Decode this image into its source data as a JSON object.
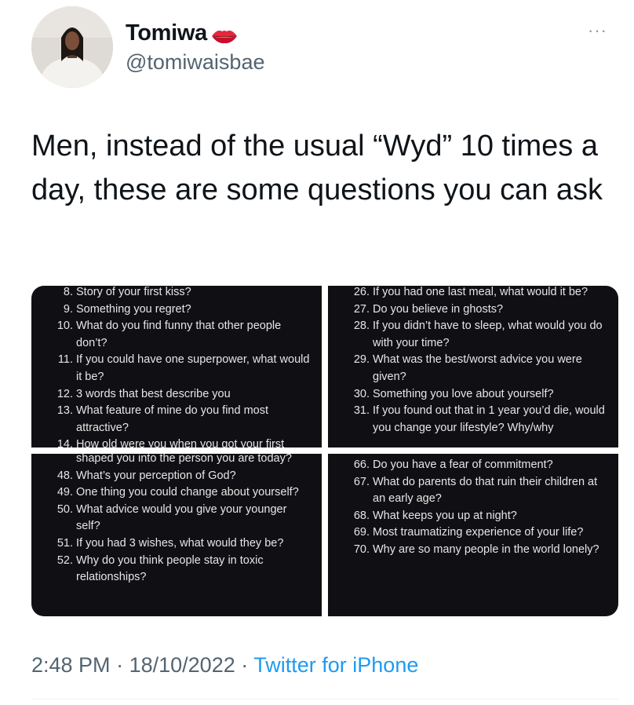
{
  "author": {
    "display_name": "Tomiwa",
    "handle": "@tomiwaisbae"
  },
  "tweet": {
    "text": "Men, instead of the usual “Wyd” 10 times a day, these are some questions you can ask"
  },
  "panels": {
    "top_left": [
      {
        "num": "8.",
        "text": "Story of your first kiss?"
      },
      {
        "num": "9.",
        "text": "Something you regret?"
      },
      {
        "num": "10.",
        "text": "What do you find funny that other people don’t?"
      },
      {
        "num": "11.",
        "text": "If you could have one superpower, what would it be?"
      },
      {
        "num": "12.",
        "text": "3 words that best describe you"
      },
      {
        "num": "13.",
        "text": "What feature of mine do you find most attractive?"
      },
      {
        "num": "14.",
        "text": "How old were you when you got your first"
      }
    ],
    "top_right": [
      {
        "num": "26.",
        "text": "If you had one last meal, what would it be?"
      },
      {
        "num": "27.",
        "text": "Do you believe in ghosts?"
      },
      {
        "num": "28.",
        "text": "If you didn’t have to sleep, what would you do with your time?"
      },
      {
        "num": "29.",
        "text": "What was the best/worst advice you were given?"
      },
      {
        "num": "30.",
        "text": "Something you love about yourself?"
      },
      {
        "num": "31.",
        "text": "If you found out that in 1 year you’d die, would you change your lifestyle? Why/why"
      }
    ],
    "bottom_left": [
      {
        "num": "",
        "text": "shaped you into the person you are today?"
      },
      {
        "num": "48.",
        "text": "What’s your perception of God?"
      },
      {
        "num": "49.",
        "text": "One thing you could change about yourself?"
      },
      {
        "num": "50.",
        "text": "What advice would you give your younger self?"
      },
      {
        "num": "51.",
        "text": "If you had 3 wishes, what would they be?"
      },
      {
        "num": "52.",
        "text": "Why do you think people stay in toxic relationships?"
      }
    ],
    "bottom_right": [
      {
        "num": "66.",
        "text": "Do you have a fear of commitment?"
      },
      {
        "num": "67.",
        "text": "What do parents do that ruin their children at an early age?"
      },
      {
        "num": "68.",
        "text": "What keeps you up at night?"
      },
      {
        "num": "69.",
        "text": "Most traumatizing experience of your life?"
      },
      {
        "num": "70.",
        "text": "Why are so many people in the world lonely?"
      }
    ]
  },
  "meta": {
    "time": "2:48 PM",
    "date": "18/10/2022",
    "separator": "·",
    "source": "Twitter for iPhone"
  },
  "more_glyph": "···",
  "colors": {
    "text": "#0f1419",
    "muted": "#536471",
    "link": "#1d9bf0",
    "panel_bg": "#101014"
  }
}
